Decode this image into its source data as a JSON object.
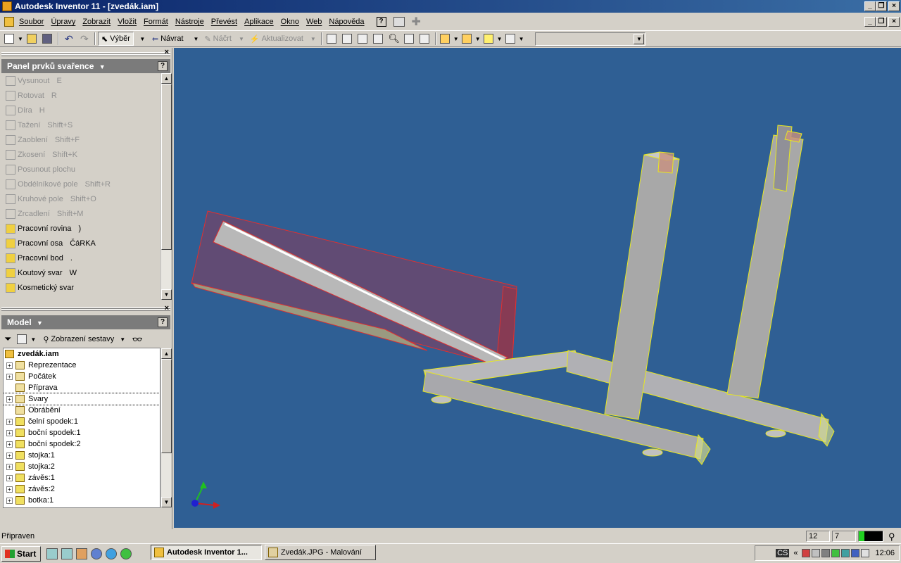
{
  "window": {
    "title": "Autodesk Inventor 11 - [zvedák.iam]"
  },
  "menu": [
    "Soubor",
    "Úpravy",
    "Zobrazit",
    "Vložit",
    "Formát",
    "Nástroje",
    "Převést",
    "Aplikace",
    "Okno",
    "Web",
    "Nápověda"
  ],
  "toolbar": {
    "select_label": "Výběr",
    "back_label": "Návrat",
    "sketch_label": "Náčrt",
    "update_label": "Aktualizovat",
    "style_combo_value": ""
  },
  "weld_panel": {
    "title": "Panel prvků svařence",
    "items": [
      {
        "label": "Vysunout",
        "shortcut": "E",
        "enabled": false
      },
      {
        "label": "Rotovat",
        "shortcut": "R",
        "enabled": false
      },
      {
        "label": "Díra",
        "shortcut": "H",
        "enabled": false
      },
      {
        "label": "Tažení",
        "shortcut": "Shift+S",
        "enabled": false
      },
      {
        "label": "Zaoblení",
        "shortcut": "Shift+F",
        "enabled": false
      },
      {
        "label": "Zkosení",
        "shortcut": "Shift+K",
        "enabled": false
      },
      {
        "label": "Posunout plochu",
        "shortcut": "",
        "enabled": false
      },
      {
        "label": "Obdélníkové pole",
        "shortcut": "Shift+R",
        "enabled": false
      },
      {
        "label": "Kruhové pole",
        "shortcut": "Shift+O",
        "enabled": false
      },
      {
        "label": "Zrcadlení",
        "shortcut": "Shift+M",
        "enabled": false
      },
      {
        "label": "Pracovní rovina",
        "shortcut": ")",
        "enabled": true
      },
      {
        "label": "Pracovní osa",
        "shortcut": "ČáRKA",
        "enabled": true
      },
      {
        "label": "Pracovní bod",
        "shortcut": ".",
        "enabled": true
      },
      {
        "label": "Koutový svar",
        "shortcut": "W",
        "enabled": true
      },
      {
        "label": "Kosmetický svar",
        "shortcut": "",
        "enabled": true
      }
    ]
  },
  "model_panel": {
    "title": "Model",
    "view_label": "Zobrazení sestavy",
    "root": "zvedák.iam",
    "nodes": [
      {
        "label": "Reprezentace",
        "expandable": true
      },
      {
        "label": "Počátek",
        "expandable": true
      },
      {
        "label": "Příprava",
        "expandable": false
      },
      {
        "label": "Svary",
        "expandable": true,
        "selected": true
      },
      {
        "label": "Obrábění",
        "expandable": false
      },
      {
        "label": "čelní spodek:1",
        "expandable": true
      },
      {
        "label": "boční spodek:1",
        "expandable": true
      },
      {
        "label": "boční spodek:2",
        "expandable": true
      },
      {
        "label": "stojka:1",
        "expandable": true
      },
      {
        "label": "stojka:2",
        "expandable": true
      },
      {
        "label": "závěs:1",
        "expandable": true
      },
      {
        "label": "závěs:2",
        "expandable": true
      },
      {
        "label": "botka:1",
        "expandable": true
      }
    ]
  },
  "status": {
    "text": "Připraven",
    "field1": "12",
    "field2": "7"
  },
  "taskbar": {
    "start_label": "Start",
    "tasks": [
      {
        "label": "Autodesk Inventor 1...",
        "active": true
      },
      {
        "label": "Zvedák.JPG - Malování",
        "active": false
      }
    ],
    "clock": "12:06",
    "lang": "CS"
  },
  "colors": {
    "viewport": "#2f5f94",
    "panel_header": "#7b7b7b",
    "title_active": "#0a246a"
  }
}
